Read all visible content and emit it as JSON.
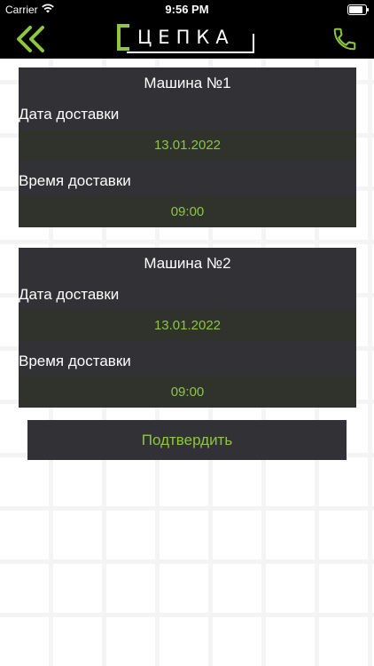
{
  "status_bar": {
    "carrier": "Carrier",
    "time": "9:56 PM",
    "battery_level": 0.9
  },
  "header": {
    "logo_text": "ЦЕПКА",
    "back_icon": "chevron-left-icon",
    "call_icon": "phone-icon",
    "accent_color": "#8dc63f"
  },
  "cars": [
    {
      "title": "Машина №1",
      "date_label": "Дата доставки",
      "date_value": "13.01.2022",
      "time_label": "Время доставки",
      "time_value": "09:00"
    },
    {
      "title": "Машина №2",
      "date_label": "Дата доставки",
      "date_value": "13.01.2022",
      "time_label": "Время доставки",
      "time_value": "09:00"
    }
  ],
  "confirm_button": {
    "label": "Подтвердить"
  }
}
